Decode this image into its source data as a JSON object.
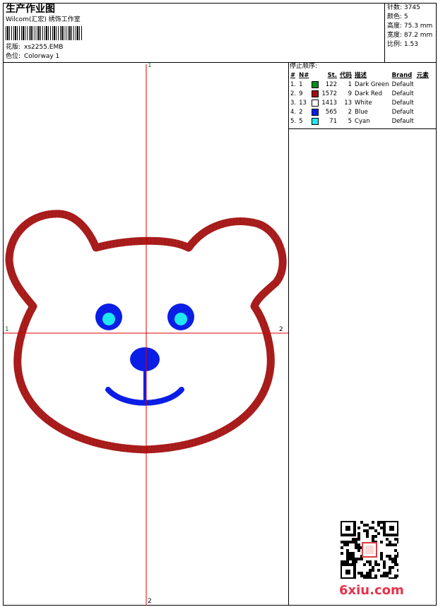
{
  "header": {
    "title": "生产作业图",
    "company": "Wilcom(汇宏) 绣饰工作室",
    "design_label": "花版:",
    "design_value": "xs2255.EMB",
    "color_label": "色位:",
    "color_value": "Colorway 1"
  },
  "stats": {
    "stitches": "针数: 3745",
    "colors": "颜色: 5",
    "height": "高度: 75.3 mm",
    "width": "宽度: 87.2 mm",
    "scale": "比例: 1.53"
  },
  "stop_sequence": {
    "title": "停止顺序:",
    "headers": [
      "#",
      "N#",
      "St.",
      "代码",
      "描述",
      "Brand",
      "元素"
    ],
    "rows": [
      {
        "idx": "1.",
        "n": "1",
        "color": "#0a8a1e",
        "st": "122",
        "code": "1",
        "desc": "Dark Green",
        "brand": "Default"
      },
      {
        "idx": "2.",
        "n": "9",
        "color": "#a01010",
        "st": "1572",
        "code": "9",
        "desc": "Dark Red",
        "brand": "Default"
      },
      {
        "idx": "3.",
        "n": "13",
        "color": "#ffffff",
        "st": "1413",
        "code": "13",
        "desc": "White",
        "brand": "Default"
      },
      {
        "idx": "4.",
        "n": "2",
        "color": "#0a1ee6",
        "st": "565",
        "code": "2",
        "desc": "Blue",
        "brand": "Default"
      },
      {
        "idx": "5.",
        "n": "5",
        "color": "#20e6f0",
        "st": "71",
        "code": "5",
        "desc": "Cyan",
        "brand": "Default"
      }
    ]
  },
  "axes": {
    "top": "1",
    "bottom": "2",
    "left": "1",
    "right": "2"
  },
  "logo": "6xiu.com",
  "colors": {
    "axis": "#e00000",
    "outline": "#a01010",
    "blue": "#0a1ee6",
    "cyan": "#20e6f0"
  }
}
